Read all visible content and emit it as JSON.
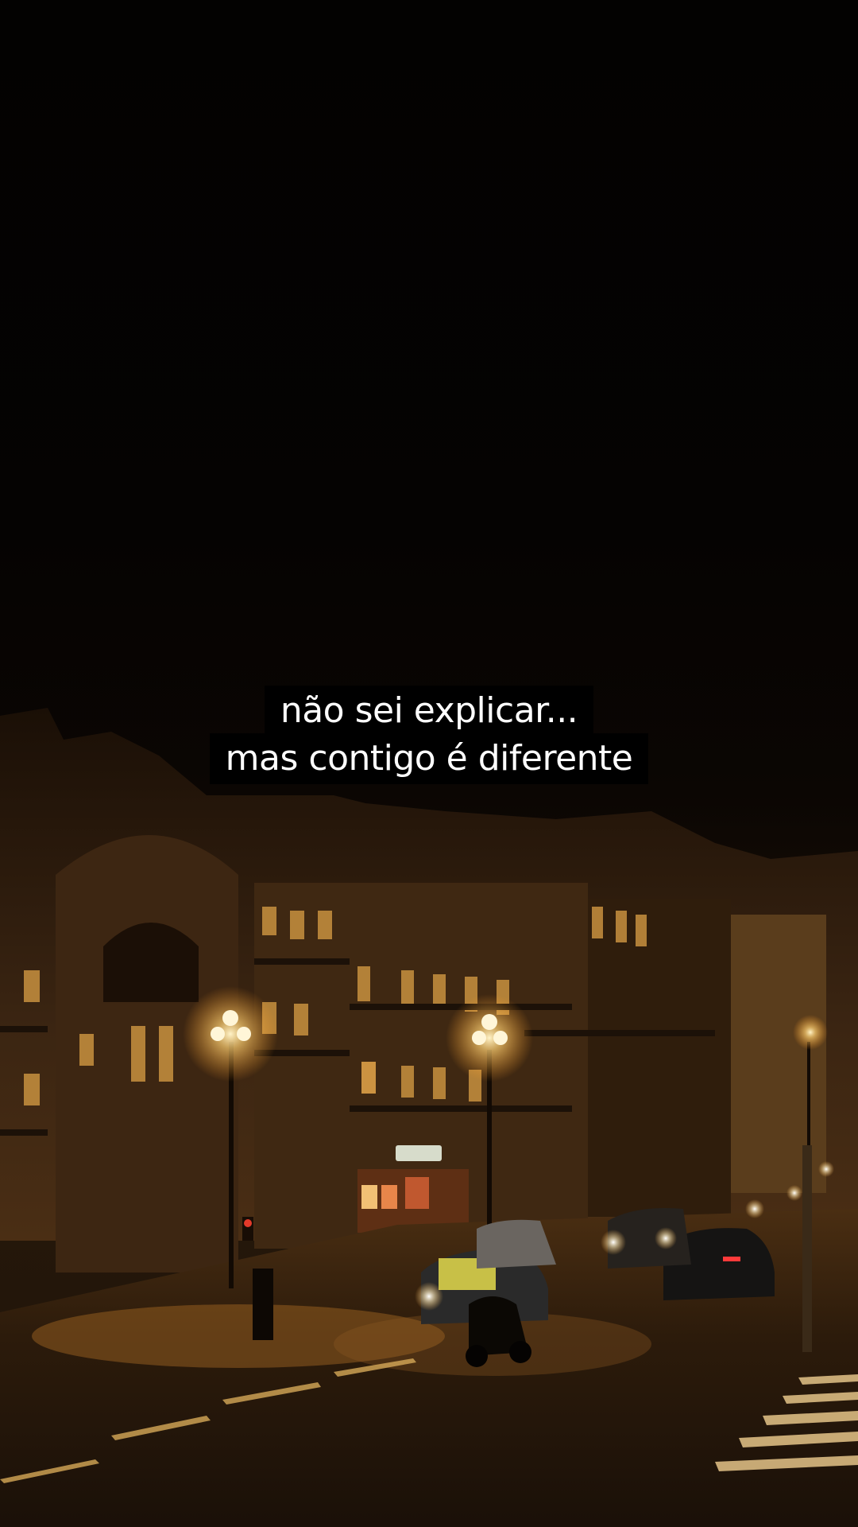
{
  "caption": {
    "line1": "não sei explicar...",
    "line2": "mas contigo é diferente"
  },
  "scene": {
    "description_icon": "night-street-photo",
    "palette": {
      "sky": "#040302",
      "building": "#3a2410",
      "lamp": "#ffd98a",
      "road": "#2a1a0a",
      "crosswalk": "#e8c98a"
    }
  }
}
